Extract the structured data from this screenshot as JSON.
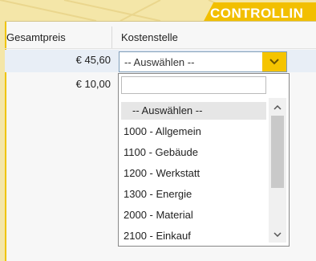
{
  "banner": {
    "label": "CONTROLLIN"
  },
  "table": {
    "columns": [
      "Gesamtpreis",
      "Kostenstelle"
    ],
    "rows": [
      {
        "price": "€ 45,60"
      },
      {
        "price": "€ 10,00"
      }
    ]
  },
  "select": {
    "value": "-- Auswählen --"
  },
  "dropdown": {
    "options": [
      "-- Auswählen --",
      "1000 - Allgemein",
      "1100 - Gebäude",
      "1200 - Werkstatt",
      "1300 - Energie",
      "2000 - Material",
      "2100 - Einkauf"
    ]
  },
  "colors": {
    "accent": "#f2bf00",
    "background": "#f4e6a8",
    "selected_row": "#e8eef6"
  }
}
